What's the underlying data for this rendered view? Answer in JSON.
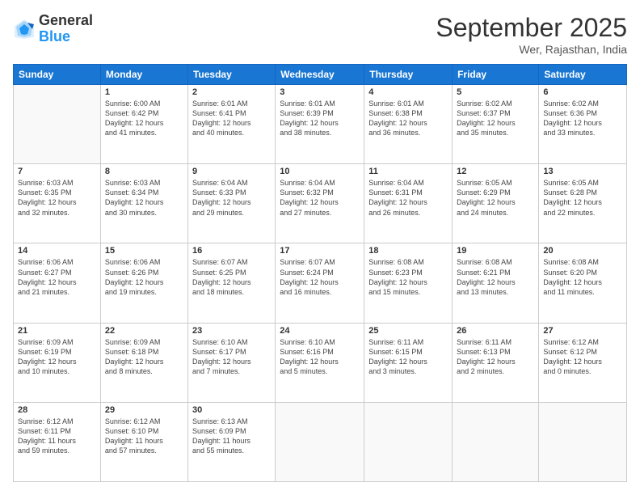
{
  "header": {
    "logo": {
      "line1": "General",
      "line2": "Blue"
    },
    "title": "September 2025",
    "subtitle": "Wer, Rajasthan, India"
  },
  "days_of_week": [
    "Sunday",
    "Monday",
    "Tuesday",
    "Wednesday",
    "Thursday",
    "Friday",
    "Saturday"
  ],
  "weeks": [
    [
      {
        "day": "",
        "info": ""
      },
      {
        "day": "1",
        "info": "Sunrise: 6:00 AM\nSunset: 6:42 PM\nDaylight: 12 hours\nand 41 minutes."
      },
      {
        "day": "2",
        "info": "Sunrise: 6:01 AM\nSunset: 6:41 PM\nDaylight: 12 hours\nand 40 minutes."
      },
      {
        "day": "3",
        "info": "Sunrise: 6:01 AM\nSunset: 6:39 PM\nDaylight: 12 hours\nand 38 minutes."
      },
      {
        "day": "4",
        "info": "Sunrise: 6:01 AM\nSunset: 6:38 PM\nDaylight: 12 hours\nand 36 minutes."
      },
      {
        "day": "5",
        "info": "Sunrise: 6:02 AM\nSunset: 6:37 PM\nDaylight: 12 hours\nand 35 minutes."
      },
      {
        "day": "6",
        "info": "Sunrise: 6:02 AM\nSunset: 6:36 PM\nDaylight: 12 hours\nand 33 minutes."
      }
    ],
    [
      {
        "day": "7",
        "info": "Sunrise: 6:03 AM\nSunset: 6:35 PM\nDaylight: 12 hours\nand 32 minutes."
      },
      {
        "day": "8",
        "info": "Sunrise: 6:03 AM\nSunset: 6:34 PM\nDaylight: 12 hours\nand 30 minutes."
      },
      {
        "day": "9",
        "info": "Sunrise: 6:04 AM\nSunset: 6:33 PM\nDaylight: 12 hours\nand 29 minutes."
      },
      {
        "day": "10",
        "info": "Sunrise: 6:04 AM\nSunset: 6:32 PM\nDaylight: 12 hours\nand 27 minutes."
      },
      {
        "day": "11",
        "info": "Sunrise: 6:04 AM\nSunset: 6:31 PM\nDaylight: 12 hours\nand 26 minutes."
      },
      {
        "day": "12",
        "info": "Sunrise: 6:05 AM\nSunset: 6:29 PM\nDaylight: 12 hours\nand 24 minutes."
      },
      {
        "day": "13",
        "info": "Sunrise: 6:05 AM\nSunset: 6:28 PM\nDaylight: 12 hours\nand 22 minutes."
      }
    ],
    [
      {
        "day": "14",
        "info": "Sunrise: 6:06 AM\nSunset: 6:27 PM\nDaylight: 12 hours\nand 21 minutes."
      },
      {
        "day": "15",
        "info": "Sunrise: 6:06 AM\nSunset: 6:26 PM\nDaylight: 12 hours\nand 19 minutes."
      },
      {
        "day": "16",
        "info": "Sunrise: 6:07 AM\nSunset: 6:25 PM\nDaylight: 12 hours\nand 18 minutes."
      },
      {
        "day": "17",
        "info": "Sunrise: 6:07 AM\nSunset: 6:24 PM\nDaylight: 12 hours\nand 16 minutes."
      },
      {
        "day": "18",
        "info": "Sunrise: 6:08 AM\nSunset: 6:23 PM\nDaylight: 12 hours\nand 15 minutes."
      },
      {
        "day": "19",
        "info": "Sunrise: 6:08 AM\nSunset: 6:21 PM\nDaylight: 12 hours\nand 13 minutes."
      },
      {
        "day": "20",
        "info": "Sunrise: 6:08 AM\nSunset: 6:20 PM\nDaylight: 12 hours\nand 11 minutes."
      }
    ],
    [
      {
        "day": "21",
        "info": "Sunrise: 6:09 AM\nSunset: 6:19 PM\nDaylight: 12 hours\nand 10 minutes."
      },
      {
        "day": "22",
        "info": "Sunrise: 6:09 AM\nSunset: 6:18 PM\nDaylight: 12 hours\nand 8 minutes."
      },
      {
        "day": "23",
        "info": "Sunrise: 6:10 AM\nSunset: 6:17 PM\nDaylight: 12 hours\nand 7 minutes."
      },
      {
        "day": "24",
        "info": "Sunrise: 6:10 AM\nSunset: 6:16 PM\nDaylight: 12 hours\nand 5 minutes."
      },
      {
        "day": "25",
        "info": "Sunrise: 6:11 AM\nSunset: 6:15 PM\nDaylight: 12 hours\nand 3 minutes."
      },
      {
        "day": "26",
        "info": "Sunrise: 6:11 AM\nSunset: 6:13 PM\nDaylight: 12 hours\nand 2 minutes."
      },
      {
        "day": "27",
        "info": "Sunrise: 6:12 AM\nSunset: 6:12 PM\nDaylight: 12 hours\nand 0 minutes."
      }
    ],
    [
      {
        "day": "28",
        "info": "Sunrise: 6:12 AM\nSunset: 6:11 PM\nDaylight: 11 hours\nand 59 minutes."
      },
      {
        "day": "29",
        "info": "Sunrise: 6:12 AM\nSunset: 6:10 PM\nDaylight: 11 hours\nand 57 minutes."
      },
      {
        "day": "30",
        "info": "Sunrise: 6:13 AM\nSunset: 6:09 PM\nDaylight: 11 hours\nand 55 minutes."
      },
      {
        "day": "",
        "info": ""
      },
      {
        "day": "",
        "info": ""
      },
      {
        "day": "",
        "info": ""
      },
      {
        "day": "",
        "info": ""
      }
    ]
  ]
}
